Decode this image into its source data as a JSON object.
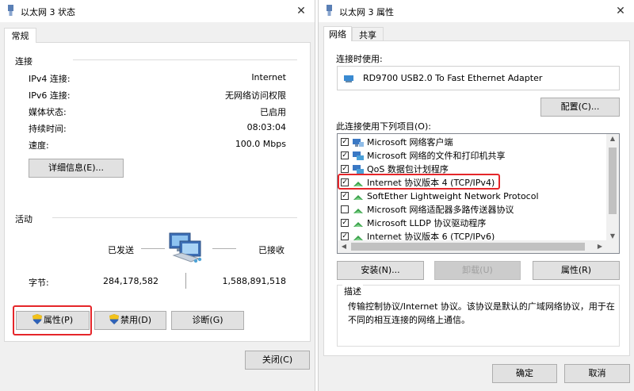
{
  "status_window": {
    "title": "以太网 3 状态",
    "close_glyph": "✕",
    "tab": "常规",
    "connection": {
      "heading": "连接",
      "rows": [
        {
          "label": "IPv4 连接:",
          "value": "Internet"
        },
        {
          "label": "IPv6 连接:",
          "value": "无网络访问权限"
        },
        {
          "label": "媒体状态:",
          "value": "已启用"
        },
        {
          "label": "持续时间:",
          "value": "08:03:04"
        },
        {
          "label": "速度:",
          "value": "100.0 Mbps"
        }
      ],
      "details_button": "详细信息(E)..."
    },
    "activity": {
      "heading": "活动",
      "sent_label": "已发送",
      "received_label": "已接收",
      "bytes_label": "字节:",
      "bytes_sent": "284,178,582",
      "bytes_received": "1,588,891,518"
    },
    "buttons": {
      "properties": "属性(P)",
      "disable": "禁用(D)",
      "diagnose": "诊断(G)",
      "close": "关闭(C)"
    }
  },
  "properties_window": {
    "title": "以太网 3 属性",
    "close_glyph": "✕",
    "tabs": [
      "网络",
      "共享"
    ],
    "connect_using_label": "连接时使用:",
    "adapter_name": "RD9700 USB2.0 To Fast Ethernet Adapter",
    "configure_button": "配置(C)...",
    "items_label": "此连接使用下列项目(O):",
    "items": [
      {
        "checked": true,
        "icon": "client-icon",
        "text": "Microsoft 网络客户端"
      },
      {
        "checked": true,
        "icon": "service-icon",
        "text": "Microsoft 网络的文件和打印机共享"
      },
      {
        "checked": true,
        "icon": "service-icon",
        "text": "QoS 数据包计划程序"
      },
      {
        "checked": true,
        "icon": "protocol-icon",
        "text": "Internet 协议版本 4 (TCP/IPv4)"
      },
      {
        "checked": true,
        "icon": "protocol-icon",
        "text": "SoftEther Lightweight Network Protocol"
      },
      {
        "checked": false,
        "icon": "protocol-icon",
        "text": "Microsoft 网络适配器多路传送器协议"
      },
      {
        "checked": true,
        "icon": "protocol-icon",
        "text": "Microsoft LLDP 协议驱动程序"
      },
      {
        "checked": true,
        "icon": "protocol-icon",
        "text": "Internet 协议版本 6 (TCP/IPv6)"
      }
    ],
    "install_button": "安装(N)...",
    "uninstall_button": "卸载(U)",
    "properties_button": "属性(R)",
    "description_heading": "描述",
    "description_text_1": "传输控制协议/Internet 协议。该协议是默认的广域网络协议，用于在",
    "description_text_2": "不同的相互连接的网络上通信。",
    "ok_button": "确定",
    "cancel_button": "取消"
  },
  "colors": {
    "highlight_box": "#e5262a",
    "window_bg": "#f0f0f0",
    "panel_bg": "#ffffff"
  }
}
